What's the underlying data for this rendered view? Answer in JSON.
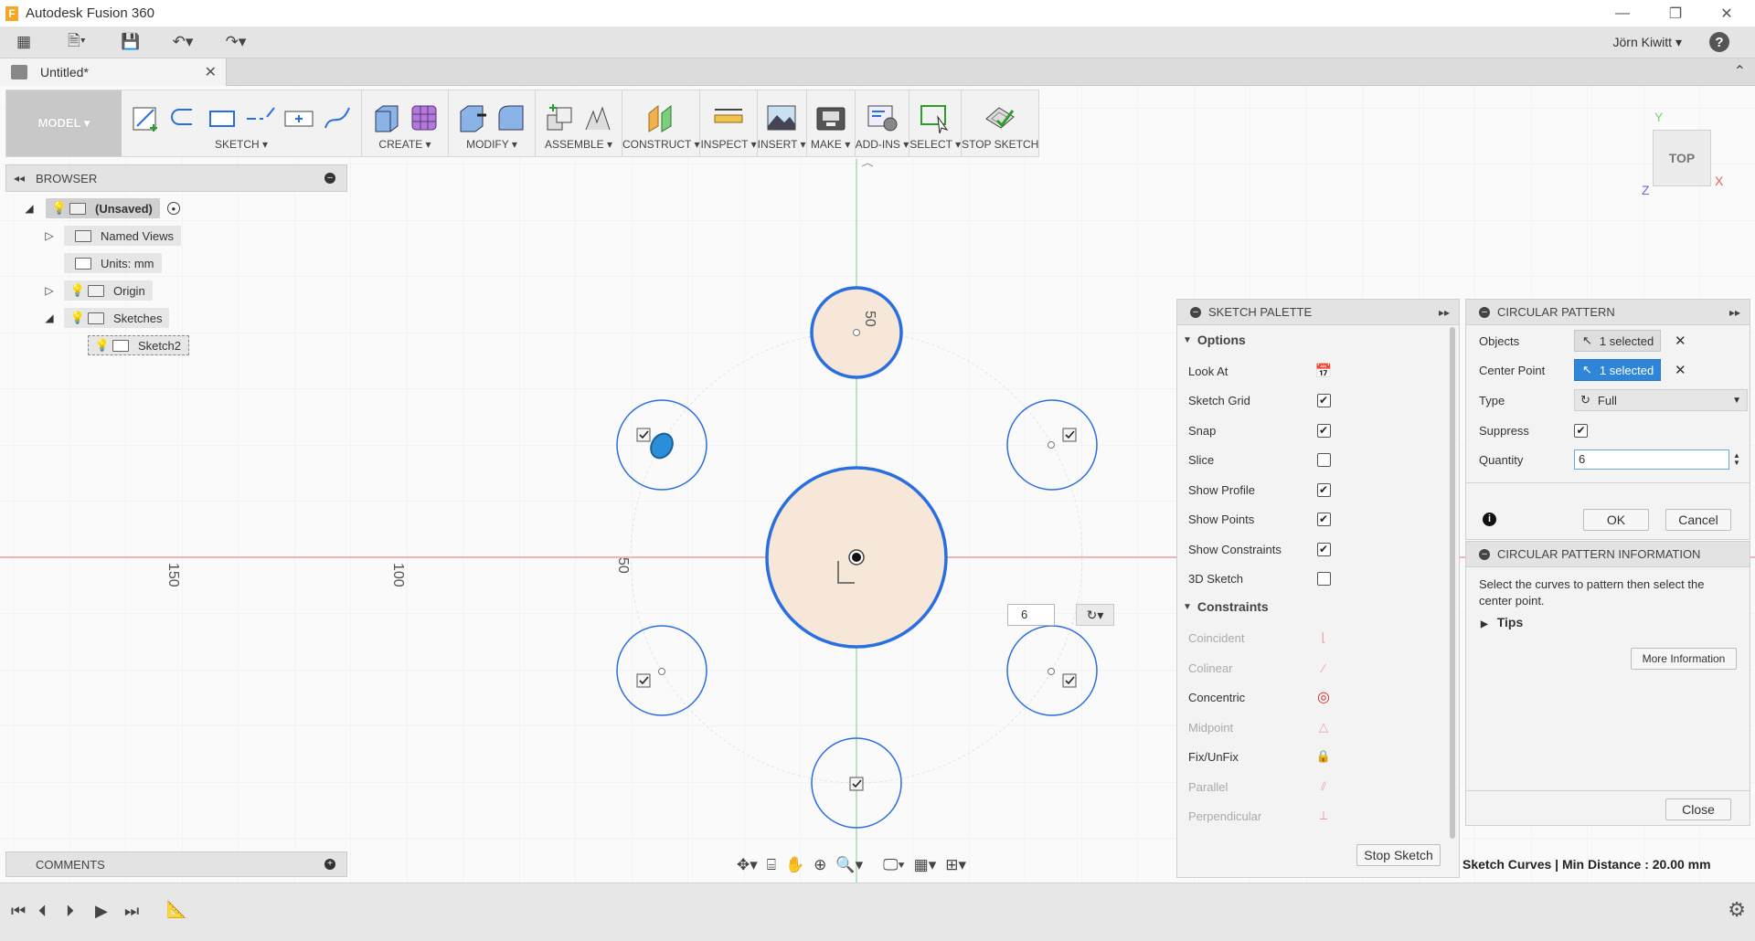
{
  "window": {
    "title": "Autodesk Fusion 360",
    "icon": "F"
  },
  "quick_access": {
    "user": "Jörn Kiwitt ▾",
    "help": "?"
  },
  "document_tab": {
    "title": "Untitled*"
  },
  "toolbar": {
    "workspace": "MODEL ▾",
    "groups": [
      {
        "label": "SKETCH ▾"
      },
      {
        "label": "CREATE ▾"
      },
      {
        "label": "MODIFY ▾"
      },
      {
        "label": "ASSEMBLE ▾"
      },
      {
        "label": "CONSTRUCT ▾"
      },
      {
        "label": "INSPECT ▾"
      },
      {
        "label": "INSERT ▾"
      },
      {
        "label": "MAKE ▾"
      },
      {
        "label": "ADD-INS ▾"
      },
      {
        "label": "SELECT ▾"
      },
      {
        "label": "STOP SKETCH"
      }
    ]
  },
  "browser": {
    "title": "BROWSER",
    "items": [
      {
        "label": "(Unsaved)"
      },
      {
        "label": "Named Views"
      },
      {
        "label": "Units: mm"
      },
      {
        "label": "Origin"
      },
      {
        "label": "Sketches"
      },
      {
        "label": "Sketch2"
      }
    ]
  },
  "comments": {
    "title": "COMMENTS"
  },
  "viewcube": {
    "face": "TOP",
    "axis_y": "Y",
    "axis_x": "X",
    "axis_z": "Z"
  },
  "canvas": {
    "ruler_labels": [
      "150",
      "100",
      "50",
      "50"
    ],
    "quantity_mini": "6"
  },
  "sketch_palette": {
    "title": "SKETCH PALETTE",
    "options_title": "Options",
    "options": [
      {
        "label": "Look At",
        "control": "look-at"
      },
      {
        "label": "Sketch Grid",
        "checked": true
      },
      {
        "label": "Snap",
        "checked": true
      },
      {
        "label": "Slice",
        "checked": false
      },
      {
        "label": "Show Profile",
        "checked": true
      },
      {
        "label": "Show Points",
        "checked": true
      },
      {
        "label": "Show Constraints",
        "checked": true
      },
      {
        "label": "3D Sketch",
        "checked": false
      }
    ],
    "constraints_title": "Constraints",
    "constraints": [
      {
        "label": "Coincident",
        "enabled": false
      },
      {
        "label": "Colinear",
        "enabled": false
      },
      {
        "label": "Concentric",
        "enabled": true
      },
      {
        "label": "Midpoint",
        "enabled": false
      },
      {
        "label": "Fix/UnFix",
        "enabled": true
      },
      {
        "label": "Parallel",
        "enabled": false
      },
      {
        "label": "Perpendicular",
        "enabled": false
      }
    ],
    "stop_sketch": "Stop Sketch"
  },
  "circular_pattern": {
    "title": "CIRCULAR PATTERN",
    "objects_label": "Objects",
    "objects_value": "1 selected",
    "center_label": "Center Point",
    "center_value": "1 selected",
    "type_label": "Type",
    "type_value": "Full",
    "suppress_label": "Suppress",
    "quantity_label": "Quantity",
    "quantity_value": "6",
    "ok": "OK",
    "cancel": "Cancel"
  },
  "circular_pattern_info": {
    "title": "CIRCULAR PATTERN INFORMATION",
    "text": "Select the curves to pattern then select the center point.",
    "tips": "Tips",
    "more": "More Information",
    "close": "Close"
  },
  "status": "Sketch Curves | Min Distance : 20.00 mm",
  "colors": {
    "accent": "#2f86d8",
    "sketch_blue": "#2a6fe0",
    "profile_fill": "#f6e7d8",
    "x_axis": "#e05a5a",
    "y_axis": "#6ccf6c"
  }
}
